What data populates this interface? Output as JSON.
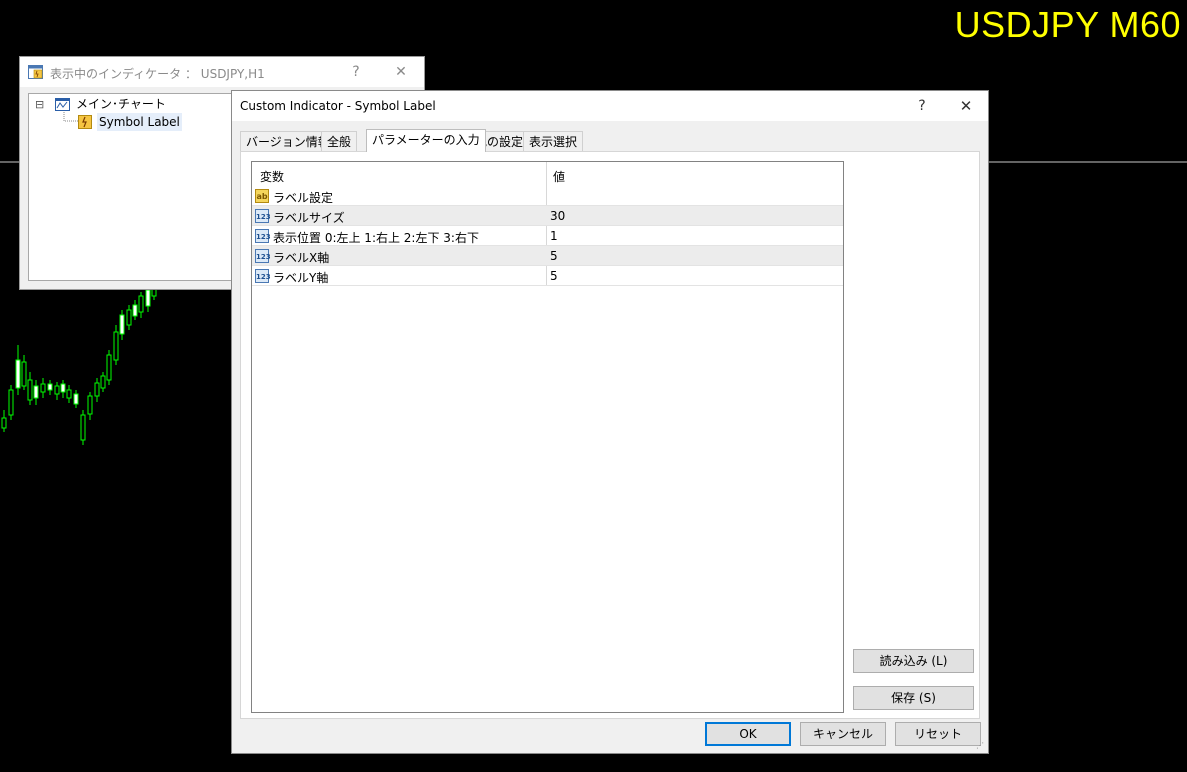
{
  "chart": {
    "symbol_label": "USDJPY M60",
    "label_color": "#ffff00",
    "candle_color": "#00ff00",
    "background": "#000000"
  },
  "back_window": {
    "title": "表示中のインディケータ ： USDJPY,H1",
    "help": "?",
    "close": "✕",
    "tree": {
      "expander": "⊟",
      "main_chart": "メイン･チャート",
      "indicator": "Symbol Label"
    }
  },
  "dialog": {
    "title": "Custom Indicator - Symbol Label",
    "help": "?",
    "close": "✕",
    "tabs": [
      {
        "label": "バージョン情報"
      },
      {
        "label": "全般"
      },
      {
        "label": "パラメーターの入力"
      },
      {
        "label": "色の設定"
      },
      {
        "label": "表示選択"
      }
    ],
    "active_tab": "パラメーターの入力",
    "grid": {
      "col_variable": "変数",
      "col_value": "値",
      "rows": [
        {
          "icon": "string-icon",
          "icon_text": "ab",
          "name": "ラベル設定",
          "value": ""
        },
        {
          "icon": "number-icon",
          "icon_text": "123",
          "name": "ラベルサイズ",
          "value": "30"
        },
        {
          "icon": "number-icon",
          "icon_text": "123",
          "name": "表示位置 0:左上 1:右上 2:左下 3:右下",
          "value": "1"
        },
        {
          "icon": "number-icon",
          "icon_text": "123",
          "name": "ラベルX軸",
          "value": "5"
        },
        {
          "icon": "number-icon",
          "icon_text": "123",
          "name": "ラベルY軸",
          "value": "5"
        }
      ]
    },
    "load_button": "読み込み (L)",
    "save_button": "保存 (S)",
    "ok_button": "OK",
    "cancel_button": "キャンセル",
    "reset_button": "リセット"
  }
}
